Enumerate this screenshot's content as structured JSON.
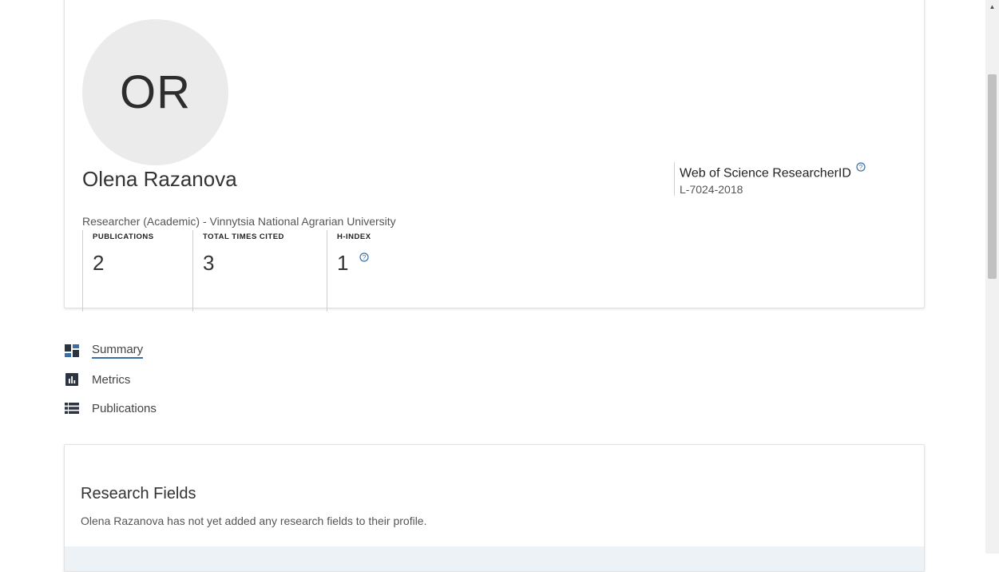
{
  "profile": {
    "initials": "OR",
    "name": "Olena Razanova",
    "affiliation": "Researcher (Academic) - Vinnytsia National Agrarian University",
    "researcher_id_label": "Web of Science ResearcherID",
    "researcher_id_value": "L-7024-2018",
    "help_icon": "?"
  },
  "stats": [
    {
      "label": "PUBLICATIONS",
      "value": "2"
    },
    {
      "label": "TOTAL TIMES CITED",
      "value": "3"
    },
    {
      "label": "H-INDEX",
      "value": "1"
    }
  ],
  "nav": {
    "items": [
      {
        "label": "Summary",
        "icon": "summary-dashboard-icon",
        "active": true
      },
      {
        "label": "Metrics",
        "icon": "bar-chart-icon",
        "active": false
      },
      {
        "label": "Publications",
        "icon": "list-icon",
        "active": false
      }
    ]
  },
  "research_fields": {
    "title": "Research Fields",
    "message": "Olena Razanova has not yet added any research fields to their profile."
  },
  "colors": {
    "accent": "#3b6ea5",
    "icon": "#2b3440",
    "avatar_bg": "#ebebeb"
  }
}
